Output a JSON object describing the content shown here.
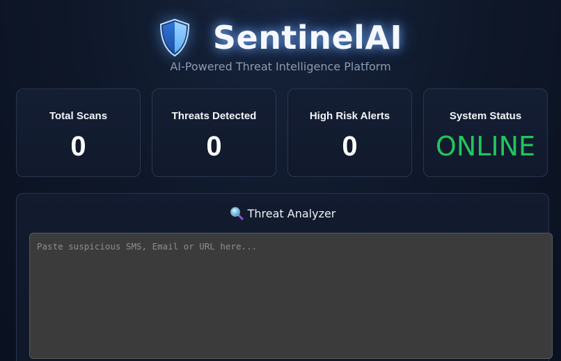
{
  "header": {
    "title": "SentinelAI",
    "subtitle": "AI-Powered Threat Intelligence Platform",
    "logo_icon": "shield-icon"
  },
  "stats": [
    {
      "label": "Total Scans",
      "value": "0"
    },
    {
      "label": "Threats Detected",
      "value": "0"
    },
    {
      "label": "High Risk Alerts",
      "value": "0"
    },
    {
      "label": "System Status",
      "value": "ONLINE"
    }
  ],
  "analyzer": {
    "icon": "magnifier-icon",
    "title": "Threat Analyzer",
    "input_value": "",
    "input_placeholder": "Paste suspicious SMS, Email or URL here..."
  },
  "colors": {
    "background": "#0e1728",
    "card_border": "#2a3650",
    "status_online": "#22c55e",
    "input_background": "#3b3b3b",
    "shield_blue": "#4aa3ff"
  }
}
